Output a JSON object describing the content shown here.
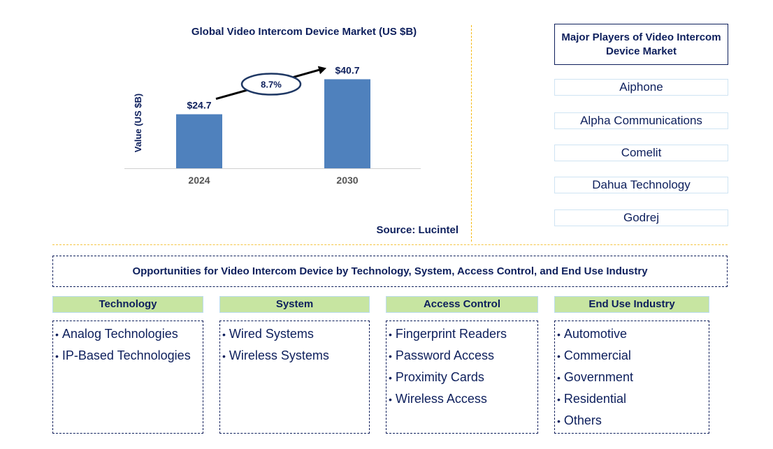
{
  "chart_data": {
    "type": "bar",
    "title": "Global Video Intercom Device Market (US $B)",
    "xlabel": "",
    "ylabel": "Value (US $B)",
    "categories": [
      "2024",
      "2030"
    ],
    "values": [
      24.7,
      40.7
    ],
    "data_labels": [
      "$24.7",
      "$40.7"
    ],
    "bar_color": "#4f81bd",
    "ylim": [
      0,
      45
    ],
    "grid": false,
    "legend": "none",
    "annotation": {
      "label": "8.7%",
      "meaning": "CAGR 2024-2030"
    }
  },
  "source": "Source: Lucintel",
  "players": {
    "title": "Major Players of Video Intercom Device Market",
    "items": [
      "Aiphone",
      "Alpha Communications",
      "Comelit",
      "Dahua Technology",
      "Godrej"
    ]
  },
  "opportunities": {
    "title": "Opportunities for Video Intercom Device by Technology, System, Access Control, and End Use Industry",
    "categories": [
      {
        "label": "Technology",
        "items": [
          "Analog Technologies",
          "IP-Based Technologies"
        ]
      },
      {
        "label": "System",
        "items": [
          "Wired Systems",
          "Wireless Systems"
        ]
      },
      {
        "label": "Access Control",
        "items": [
          "Fingerprint Readers",
          "Password Access",
          "Proximity Cards",
          "Wireless Access"
        ]
      },
      {
        "label": "End Use Industry",
        "items": [
          "Automotive",
          "Commercial",
          "Government",
          "Residential",
          "Others"
        ]
      }
    ]
  },
  "colors": {
    "text": "#0d1f5c",
    "bar": "#4f81bd",
    "header_bg": "#c7e5a1",
    "divider": "#f5b800"
  }
}
